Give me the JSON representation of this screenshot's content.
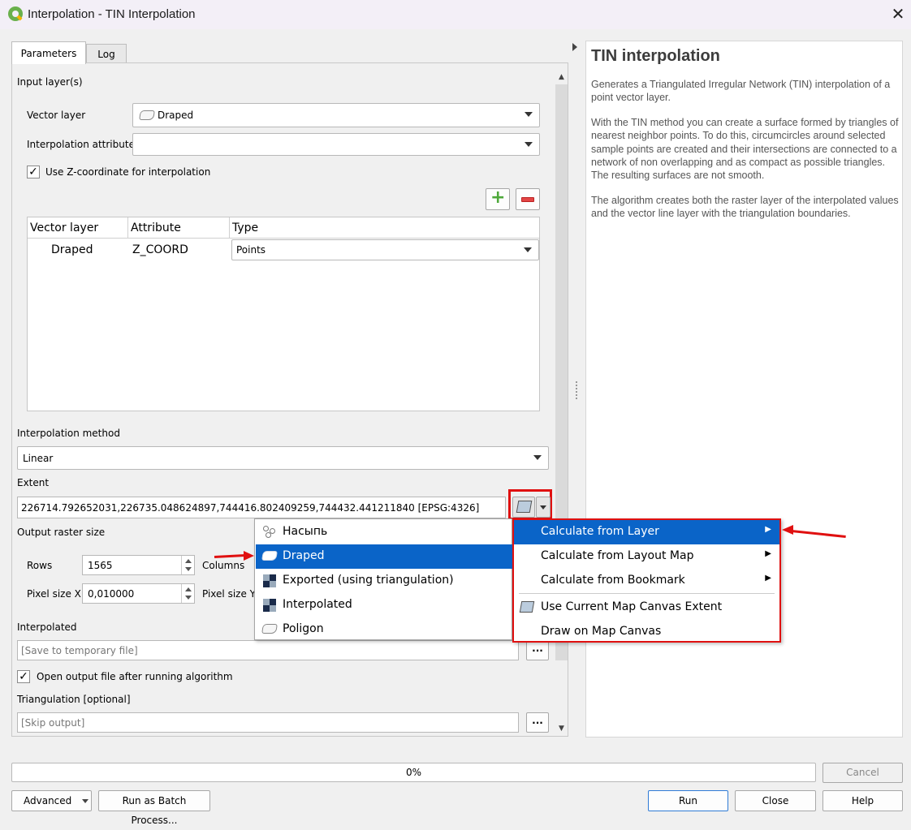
{
  "window": {
    "title": "Interpolation - TIN Interpolation",
    "close_glyph": "✕"
  },
  "tabs": [
    {
      "label": "Parameters",
      "active": true
    },
    {
      "label": "Log",
      "active": false
    }
  ],
  "params": {
    "input_layers_label": "Input layer(s)",
    "vector_layer_label": "Vector layer",
    "vector_layer_value": "Draped",
    "interp_attr_label": "Interpolation attribute",
    "interp_attr_value": "",
    "use_z_label": "Use Z-coordinate for interpolation",
    "use_z_checked": true,
    "check_glyph": "✓",
    "add_button_glyph": "+",
    "remove_button_glyph": "−",
    "table": {
      "headers": [
        "Vector layer",
        "Attribute",
        "Type"
      ],
      "rows": [
        {
          "layer": "Draped",
          "attribute": "Z_COORD",
          "type": "Points"
        }
      ]
    },
    "interp_method_label": "Interpolation method",
    "interp_method_value": "Linear",
    "extent_label": "Extent",
    "extent_value": "226714.792652031,226735.048624897,744416.802409259,744432.441211840 [EPSG:4326]",
    "output_raster_label": "Output raster size",
    "rows_label": "Rows",
    "rows_value": "1565",
    "columns_label": "Columns",
    "pixel_x_label": "Pixel size X",
    "pixel_x_value": "0,010000",
    "pixel_y_label": "Pixel size Y",
    "interpolated_label": "Interpolated",
    "interpolated_placeholder": "[Save to temporary file]",
    "browse_label": "...",
    "open_output_label": "Open output file after running algorithm",
    "open_output_checked": true,
    "triangulation_label": "Triangulation [optional]",
    "triangulation_placeholder": "[Skip output]"
  },
  "help": {
    "title": "TIN interpolation",
    "p1": "Generates a Triangulated Irregular Network (TIN) interpolation of a point vector layer.",
    "p2": "With the TIN method you can create a surface formed by triangles of nearest neighbor points. To do this, circumcircles around selected sample points are created and their intersections are connected to a network of non overlapping and as compact as possible triangles. The resulting surfaces are not smooth.",
    "p3": "The algorithm creates both the raster layer of the interpolated values and the vector line layer with the triangulation boundaries."
  },
  "layer_menu": {
    "items": [
      {
        "label": "Насыпь",
        "icon": "point-layer-icon",
        "selected": false
      },
      {
        "label": "Draped",
        "icon": "polygon-layer-icon",
        "selected": true
      },
      {
        "label": "Exported (using triangulation)",
        "icon": "raster-layer-icon",
        "selected": false
      },
      {
        "label": "Interpolated",
        "icon": "raster-layer-icon",
        "selected": false
      },
      {
        "label": "Poligon",
        "icon": "polygon-layer-icon",
        "selected": false
      }
    ]
  },
  "extent_menu": {
    "items": [
      {
        "label": "Calculate from Layer",
        "submenu": true,
        "selected": true
      },
      {
        "label": "Calculate from Layout Map",
        "submenu": true,
        "selected": false
      },
      {
        "label": "Calculate from Bookmark",
        "submenu": true,
        "selected": false
      },
      {
        "label": "Use Current Map Canvas Extent",
        "submenu": false,
        "selected": false
      },
      {
        "label": "Draw on Map Canvas",
        "submenu": false,
        "selected": false
      }
    ],
    "submenu_glyph": "▶"
  },
  "progress": {
    "value": 0,
    "text": "0%"
  },
  "footer": {
    "cancel": "Cancel",
    "advanced": "Advanced",
    "batch": "Run as Batch Process...",
    "run": "Run",
    "close": "Close",
    "help": "Help"
  },
  "colors": {
    "accent": "#0a64c8",
    "highlight_red": "#e01010"
  }
}
